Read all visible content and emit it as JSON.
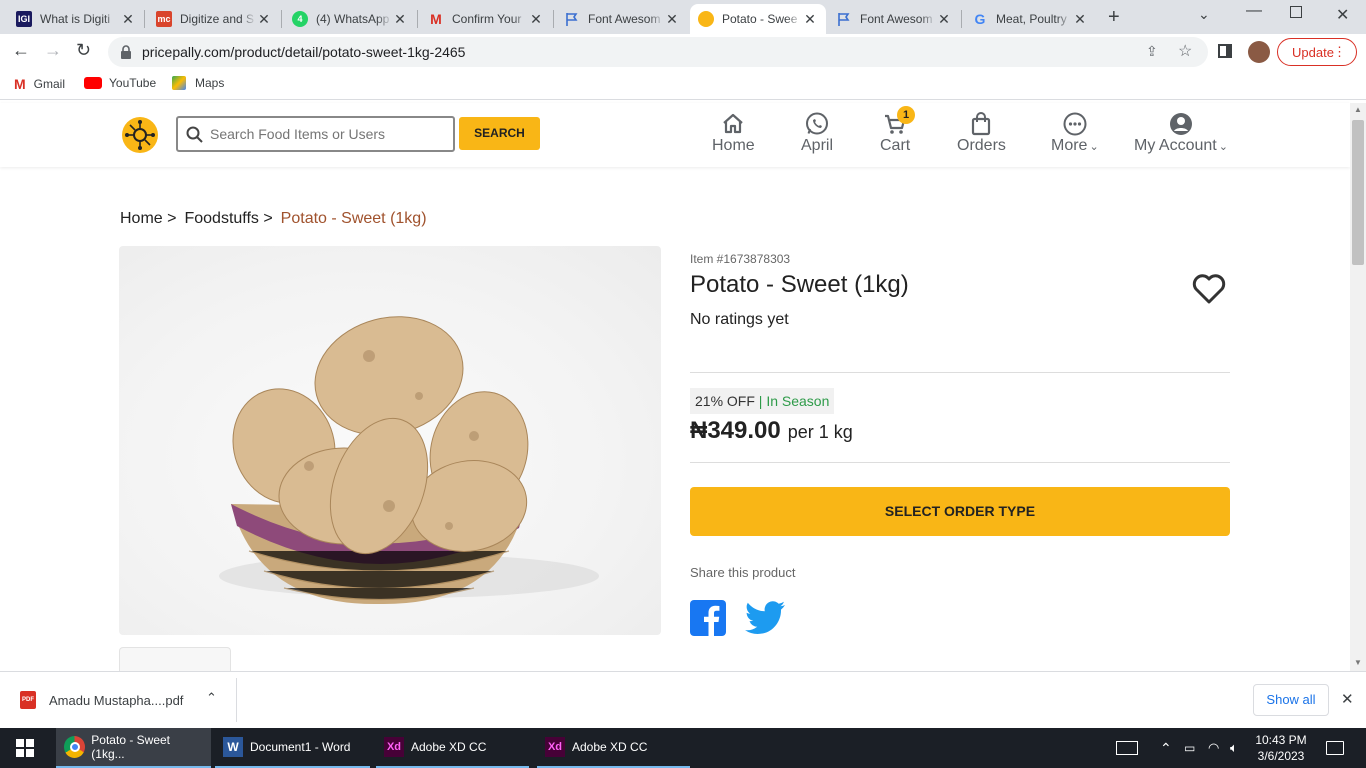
{
  "browser": {
    "tabs": [
      {
        "title": "What is Digiti",
        "favicon": "IGI"
      },
      {
        "title": "Digitize and S",
        "favicon": "mc"
      },
      {
        "title": "(4) WhatsApp",
        "favicon": "4"
      },
      {
        "title": "Confirm Your",
        "favicon": "M"
      },
      {
        "title": "Font Awesom",
        "favicon": "flag"
      },
      {
        "title": "Potato - Swee",
        "favicon": "pp",
        "active": true
      },
      {
        "title": "Font Awesom",
        "favicon": "flag"
      },
      {
        "title": "Meat, Poultry",
        "favicon": "G"
      }
    ],
    "url": "pricepally.com/product/detail/potato-sweet-1kg-2465",
    "update_label": "Update",
    "bookmarks": [
      "Gmail",
      "YouTube",
      "Maps"
    ]
  },
  "site": {
    "search_placeholder": "Search Food Items or Users",
    "search_button": "SEARCH",
    "nav": {
      "home": "Home",
      "user": "April",
      "cart": "Cart",
      "cart_count": "1",
      "orders": "Orders",
      "more": "More",
      "account": "My Account"
    }
  },
  "breadcrumb": {
    "home": "Home >",
    "category": "Foodstuffs >",
    "current": "Potato - Sweet (1kg)"
  },
  "product": {
    "item_number": "Item #1673878303",
    "title": "Potato - Sweet (1kg)",
    "ratings": "No ratings yet",
    "discount": "21% OFF",
    "separator": "|",
    "season": "In Season",
    "price": "₦349.00",
    "unit": "per 1 kg",
    "cta": "SELECT ORDER TYPE",
    "share_label": "Share this product"
  },
  "downloads": {
    "file": "Amadu Mustapha....pdf",
    "show_all": "Show all"
  },
  "taskbar": {
    "apps": [
      "Potato - Sweet (1kg...",
      "Document1 - Word",
      "Adobe XD CC",
      "Adobe XD CC"
    ],
    "time": "10:43 PM",
    "date": "3/6/2023"
  },
  "colors": {
    "accent": "#f9b616",
    "breadcrumb_active": "#a0522d",
    "season": "#2e9b49",
    "facebook": "#1877f2",
    "twitter": "#1d9bf0"
  }
}
